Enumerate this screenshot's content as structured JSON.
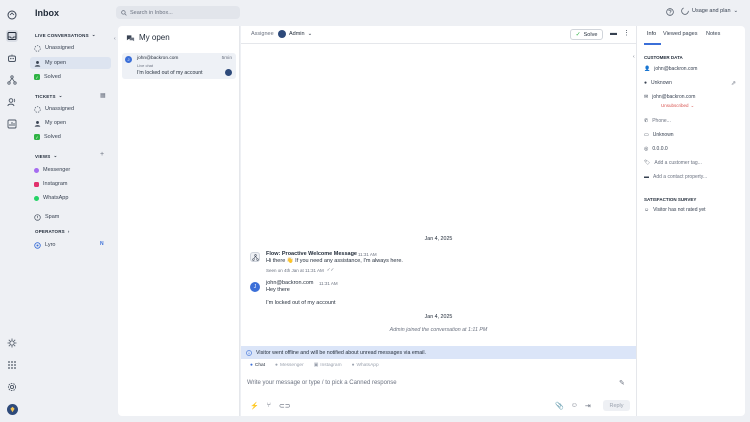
{
  "nav": {
    "title": "Inbox",
    "live_conversations": "LIVE CONVERSATIONS",
    "live_items": [
      "Unassigned",
      "My open",
      "Solved"
    ],
    "tickets": "TICKETS",
    "ticket_items": [
      "Unassigned",
      "My open",
      "Solved"
    ],
    "views": "VIEWS",
    "channels": [
      "Messenger",
      "Instagram",
      "WhatsApp"
    ],
    "spam": "Spam",
    "operators": "OPERATORS",
    "operator_name": "Lyro",
    "operator_badge": "N"
  },
  "topbar": {
    "search_placeholder": "Search in Inbox...",
    "usage_label": "Usage and plan"
  },
  "list": {
    "title": "My open",
    "conv_email": "john@backron.com",
    "conv_time": "5min",
    "conv_channel": "Live chat",
    "conv_preview": "I'm locked out of my account"
  },
  "chat": {
    "assignee_label": "Assignee",
    "assignee_name": "Admin",
    "solve_label": "Solve",
    "date1": "Jan 4, 2025",
    "bot_title": "Flow: Proactive Welcome Message",
    "bot_time": "11:31 AM",
    "bot_text": "Hi there 👋 If you need any assistance, I'm always here.",
    "seen_text": "Seen on 4th Jan at 11:31 AM",
    "user_email": "john@backron.com",
    "user_time": "11:31 AM",
    "user_msg1": "Hey there",
    "user_msg2": "I'm locked out of my account",
    "date2": "Jan 4, 2025",
    "joined_text": "Admin joined the conversation at 1:11 PM",
    "banner_text": "Visitor went offline and will be notified about unread messages via email.",
    "channel_tabs": [
      "Chat",
      "Messenger",
      "Instagram",
      "WhatsApp"
    ],
    "composer_placeholder": "Write your message or type / to pick a Canned response",
    "reply_label": "Reply"
  },
  "details": {
    "tabs": [
      "Info",
      "Viewed pages",
      "Notes"
    ],
    "customer_data": "CUSTOMER DATA",
    "email": "john@backron.com",
    "location": "Unknown",
    "email2": "john@backron.com",
    "subscription": "Unsubscribed",
    "phone_placeholder": "Phone...",
    "device": "Unknown",
    "ip": "0.0.0.0",
    "add_tag": "Add a customer tag...",
    "add_property": "Add a contact property...",
    "satisfaction": "SATISFACTION SURVEY",
    "rating": "Visitor has not rated yet"
  },
  "colors": {
    "accent": "#3b6fd8",
    "selected_bg": "#dde4f0",
    "banner_bg": "#dbe5f8",
    "unsubscribed": "#d9534f",
    "solved": "#2fb344"
  }
}
